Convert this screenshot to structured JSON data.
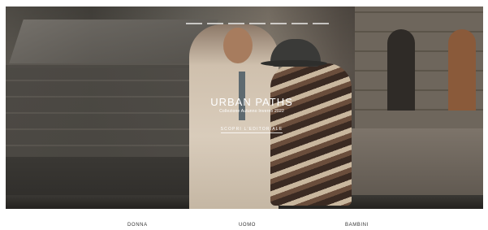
{
  "hero": {
    "title": "URBAN PATHS",
    "subtitle": "Collezione Autunno Inverno 2022",
    "cta_label": "SCOPRI L'EDITORIALE"
  },
  "categories": [
    {
      "label": "DONNA"
    },
    {
      "label": "UOMO"
    },
    {
      "label": "BAMBINI"
    }
  ],
  "colors": {
    "overlay_text": "#ffffff",
    "category_text": "#333333"
  },
  "icons": {
    "hero_nav": "nav-line-icon"
  }
}
